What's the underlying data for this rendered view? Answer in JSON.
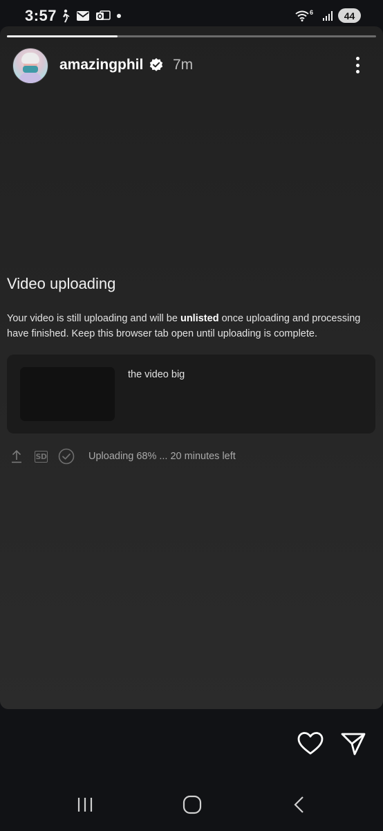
{
  "status_bar": {
    "time": "3:57",
    "network_badge": "6",
    "battery": "44",
    "icons": [
      "walking-icon",
      "mail-icon",
      "outlook-icon",
      "dot-icon",
      "wifi-icon",
      "signal-icon",
      "battery-icon"
    ]
  },
  "story": {
    "progress": 0.3,
    "user": {
      "username": "amazingphil",
      "verified": true,
      "time_ago": "7m"
    }
  },
  "upload": {
    "title": "Video uploading",
    "desc_before": "Your video is still uploading and will be ",
    "desc_bold": "unlisted",
    "desc_after": " once uploading and processing have finished. Keep this browser tab open until uploading is complete.",
    "video_title": "the video big",
    "quality_label": "SD",
    "status_text": "Uploading 68% ... 20 minutes left",
    "upload_percent": 68
  },
  "actions": {
    "icons": [
      "heart-icon",
      "send-icon"
    ]
  },
  "nav_bar": {
    "icons": [
      "recent-apps-icon",
      "home-icon",
      "back-icon"
    ]
  },
  "colors": {
    "background": "#111215",
    "story_top": "#212121",
    "story_bottom": "#2b2b2b",
    "card": "#1b1b1b",
    "muted_text": "#a9a9a9"
  }
}
